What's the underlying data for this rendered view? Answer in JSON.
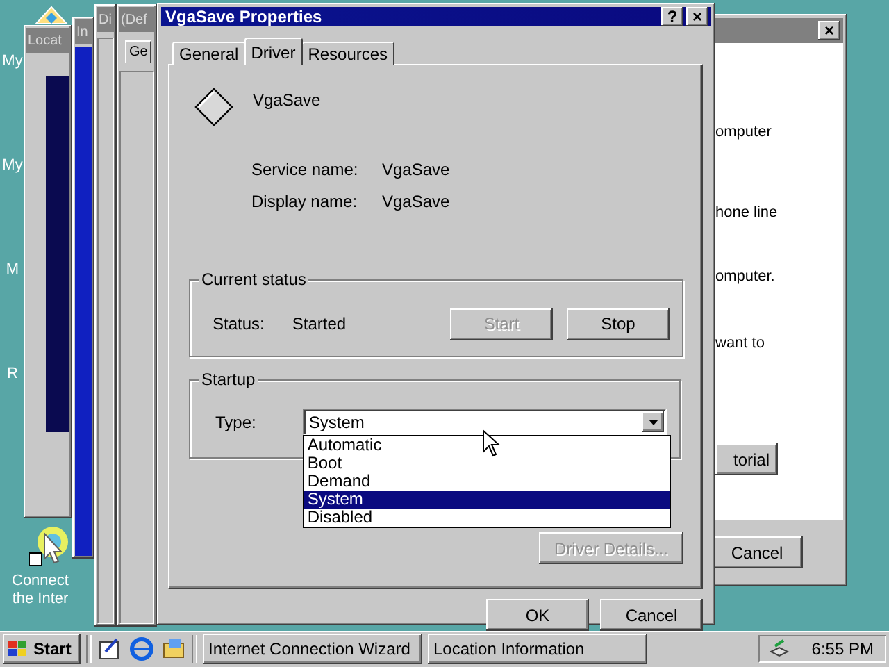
{
  "desktop_icons": [
    {
      "label": "My"
    },
    {
      "label": "My"
    },
    {
      "label": "M"
    },
    {
      "label": "R"
    },
    {
      "label": "Connect the Inter"
    }
  ],
  "back_windows": [
    {
      "title": "Locat"
    },
    {
      "title": "In"
    },
    {
      "title": "Di"
    },
    {
      "title": "(Def",
      "tab": "Ge"
    }
  ],
  "right_window": {
    "close": "×",
    "lines": [
      "omputer",
      "hone line",
      "omputer.",
      "want to"
    ],
    "buttons": [
      "torial",
      "Cancel"
    ]
  },
  "dialog": {
    "title": "VgaSave Properties",
    "help": "?",
    "close": "×",
    "tabs": [
      {
        "label": "General",
        "selected": false
      },
      {
        "label": "Driver",
        "selected": true
      },
      {
        "label": "Resources",
        "selected": false
      }
    ],
    "device_name": "VgaSave",
    "fields": [
      {
        "label": "Service name:",
        "value": "VgaSave"
      },
      {
        "label": "Display name:",
        "value": "VgaSave"
      }
    ],
    "status_group": {
      "title": "Current status",
      "label": "Status:",
      "value": "Started",
      "buttons": [
        {
          "label": "Start",
          "disabled": true
        },
        {
          "label": "Stop",
          "disabled": false
        }
      ]
    },
    "startup_group": {
      "title": "Startup",
      "label": "Type:",
      "value": "System",
      "expanded": true,
      "options": [
        {
          "label": "Automatic",
          "selected": false
        },
        {
          "label": "Boot",
          "selected": false
        },
        {
          "label": "Demand",
          "selected": false
        },
        {
          "label": "System",
          "selected": true
        },
        {
          "label": "Disabled",
          "selected": false
        }
      ]
    },
    "details_button": {
      "label": "Driver Details...",
      "disabled": true
    },
    "buttons": [
      "OK",
      "Cancel"
    ]
  },
  "taskbar": {
    "start": "Start",
    "tasks": [
      {
        "label": "Internet Connection Wizard"
      },
      {
        "label": "Location Information"
      }
    ],
    "clock": "6:55 PM"
  }
}
